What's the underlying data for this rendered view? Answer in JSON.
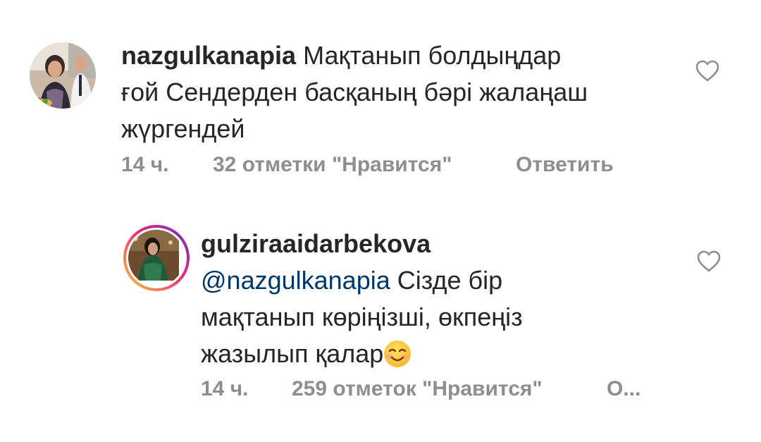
{
  "comments": [
    {
      "username": "nazgulkanapia",
      "text_line1": "Мақтанып болдыңдар",
      "text_line2": "ғой Сендерден басқаның бәрі жалаңаш",
      "text_line3": "жүргендей",
      "time": "14 ч.",
      "likes": "32 отметки \"Нравится\"",
      "reply_label": "Ответить",
      "heart_icon": "heart-outline"
    },
    {
      "username": "gulziraaidarbekova",
      "mention": "@nazgulkanapia",
      "text_line1": " Сізде бір",
      "text_line2": "мақтанып көріңізші, өкпеңіз",
      "text_line3": "жазылып қалар",
      "emoji": "smiling-face-emoji",
      "time": "14 ч.",
      "likes": "259 отметок \"Нравится\"",
      "reply_label": "О...",
      "heart_icon": "heart-outline"
    }
  ],
  "colors": {
    "text": "#262626",
    "meta": "#8e8e8e",
    "mention": "#00376b",
    "story_ring_start": "#f9ce34",
    "story_ring_end": "#6228d7"
  }
}
